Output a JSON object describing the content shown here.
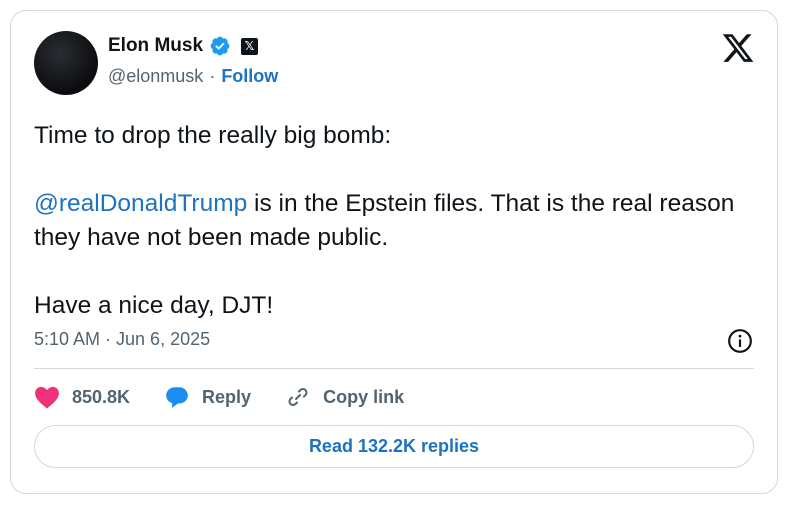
{
  "author": {
    "name": "Elon Musk",
    "handle": "@elonmusk",
    "separator": "·",
    "follow_label": "Follow"
  },
  "tweet": {
    "line1": "Time to drop the really big bomb:",
    "mention": "@realDonaldTrump",
    "line2_rest": " is in the Epstein files. That is the real reason they have not been made public.",
    "line3": "Have a nice day, DJT!",
    "timestamp": "5:10 AM · Jun 6, 2025"
  },
  "actions": {
    "likes": "850.8K",
    "reply_label": "Reply",
    "copy_link_label": "Copy link"
  },
  "replies_button": "Read 132.2K replies",
  "colors": {
    "accent": "#1d72c2",
    "like": "#f0307a",
    "reply_bubble": "#1d8cf0",
    "verified": "#1d9bf0"
  }
}
